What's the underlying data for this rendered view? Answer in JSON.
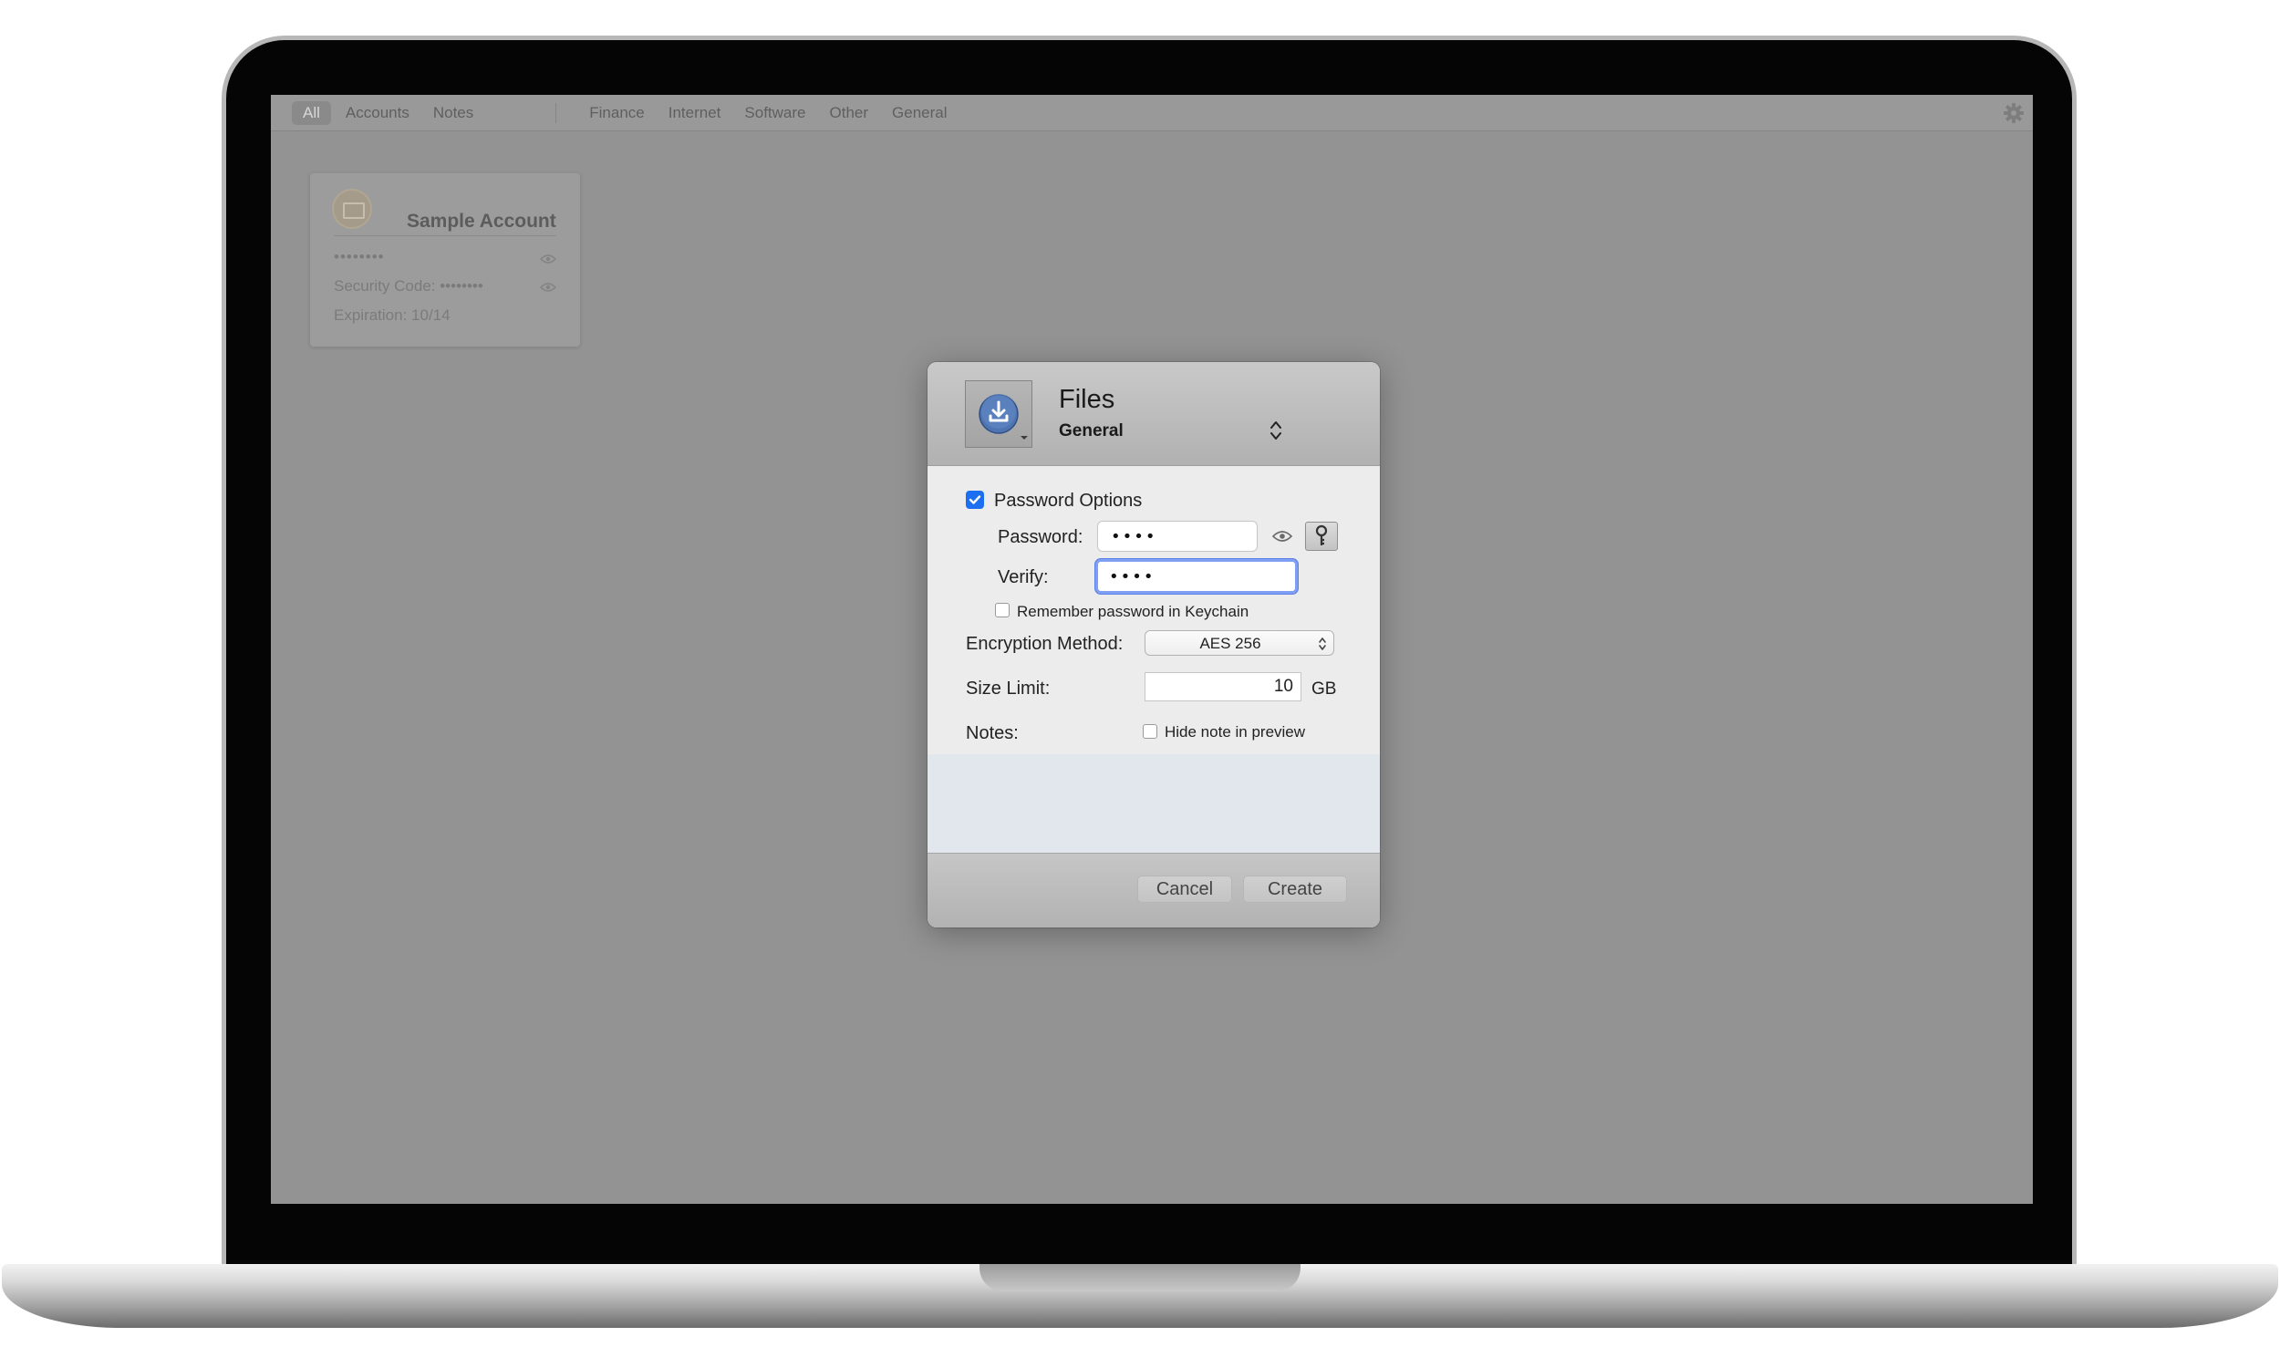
{
  "toolbar": {
    "tabs": [
      "All",
      "Accounts",
      "Notes"
    ],
    "categories": [
      "Finance",
      "Internet",
      "Software",
      "Other",
      "General"
    ]
  },
  "card": {
    "title": "Sample Account",
    "masked": "••••••••",
    "security_code": "Security Code: ••••••••",
    "expiration": "Expiration: 10/14"
  },
  "dialog": {
    "title": "Files",
    "category": "General",
    "password_options_label": "Password Options",
    "password_label": "Password:",
    "password_value": "••••",
    "verify_label": "Verify:",
    "verify_value": "••••",
    "remember_label": "Remember password in Keychain",
    "encryption_label": "Encryption Method:",
    "encryption_value": "AES 256",
    "size_label": "Size Limit:",
    "size_value": "10",
    "size_unit": "GB",
    "notes_label": "Notes:",
    "hide_note_label": "Hide note in preview",
    "cancel_label": "Cancel",
    "create_label": "Create"
  },
  "colors": {
    "checkbox_accent": "#1d6ff2",
    "focus_ring": "#7f9ff2",
    "notes_background": "#e2e6ed"
  },
  "icons": {
    "dialog_icon": "download-tray-icon",
    "reveal": "eye-icon",
    "generator": "key-icon",
    "settings": "gear-icon"
  }
}
